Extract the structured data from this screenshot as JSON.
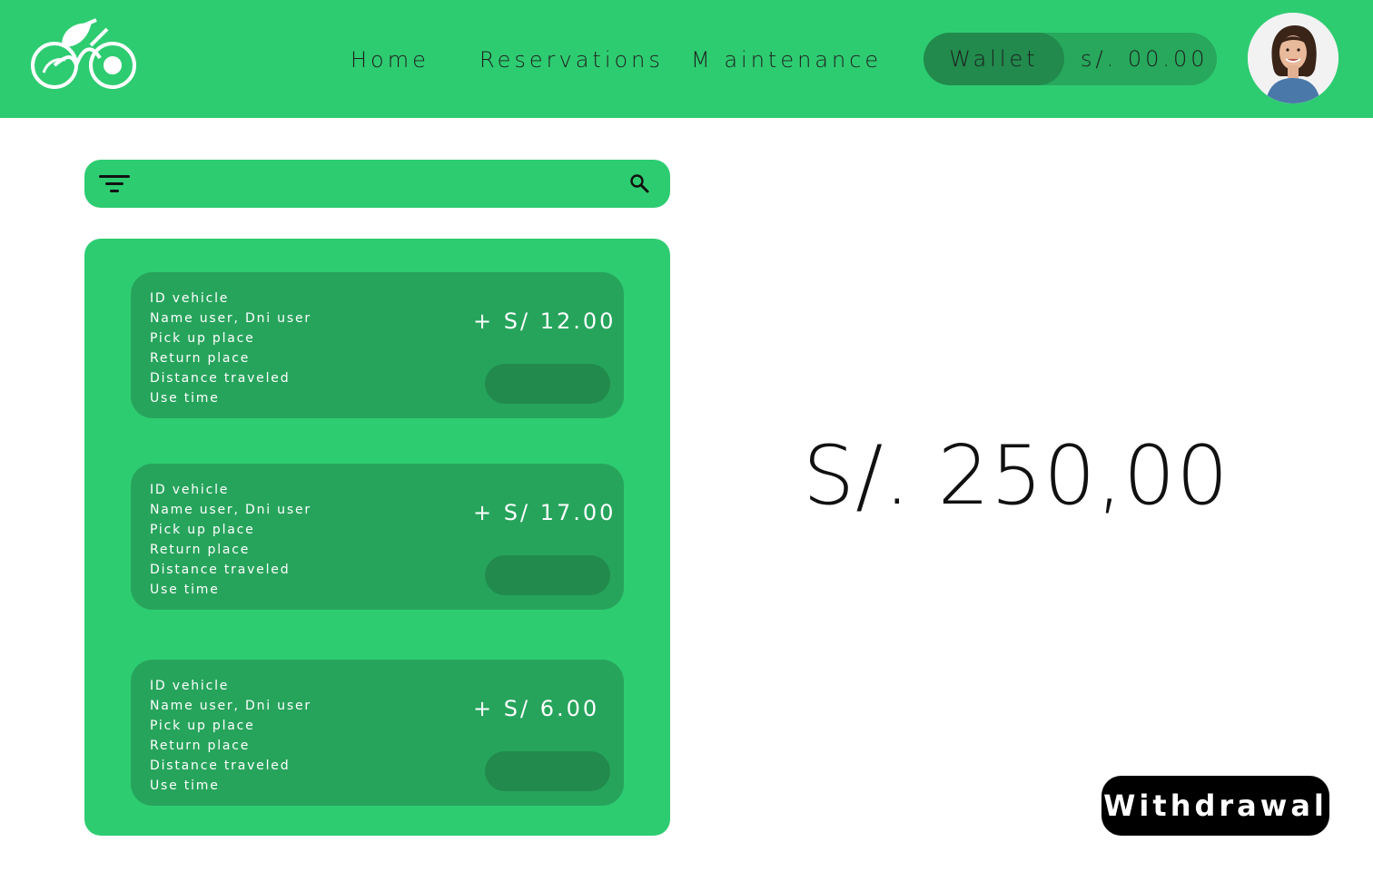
{
  "header": {
    "nav": [
      {
        "label": "Home"
      },
      {
        "label": "Reservations"
      },
      {
        "label": "M aintenance"
      }
    ],
    "wallet": {
      "label": "Wallet",
      "amount": "s/. 00.00"
    }
  },
  "search": {
    "placeholder": ""
  },
  "transactions": [
    {
      "lines": [
        "ID vehicle",
        "Name user, Dni user",
        "Pick up place",
        "Return place",
        "Distance traveled",
        "Use time"
      ],
      "amount": "+ S/ 12.00"
    },
    {
      "lines": [
        "ID vehicle",
        "Name user, Dni user",
        "Pick up place",
        "Return place",
        "Distance traveled",
        "Use time"
      ],
      "amount": "+ S/ 17.00"
    },
    {
      "lines": [
        "ID vehicle",
        "Name user, Dni user",
        "Pick up place",
        "Return place",
        "Distance traveled",
        "Use time"
      ],
      "amount": "+ S/ 6.00"
    }
  ],
  "balance": "S/. 250,00",
  "withdraw_label": "Withdrawal",
  "colors": {
    "primary": "#2ecc71",
    "card": "#27a45c",
    "dark_accent": "#218a4c",
    "button": "#000000"
  }
}
